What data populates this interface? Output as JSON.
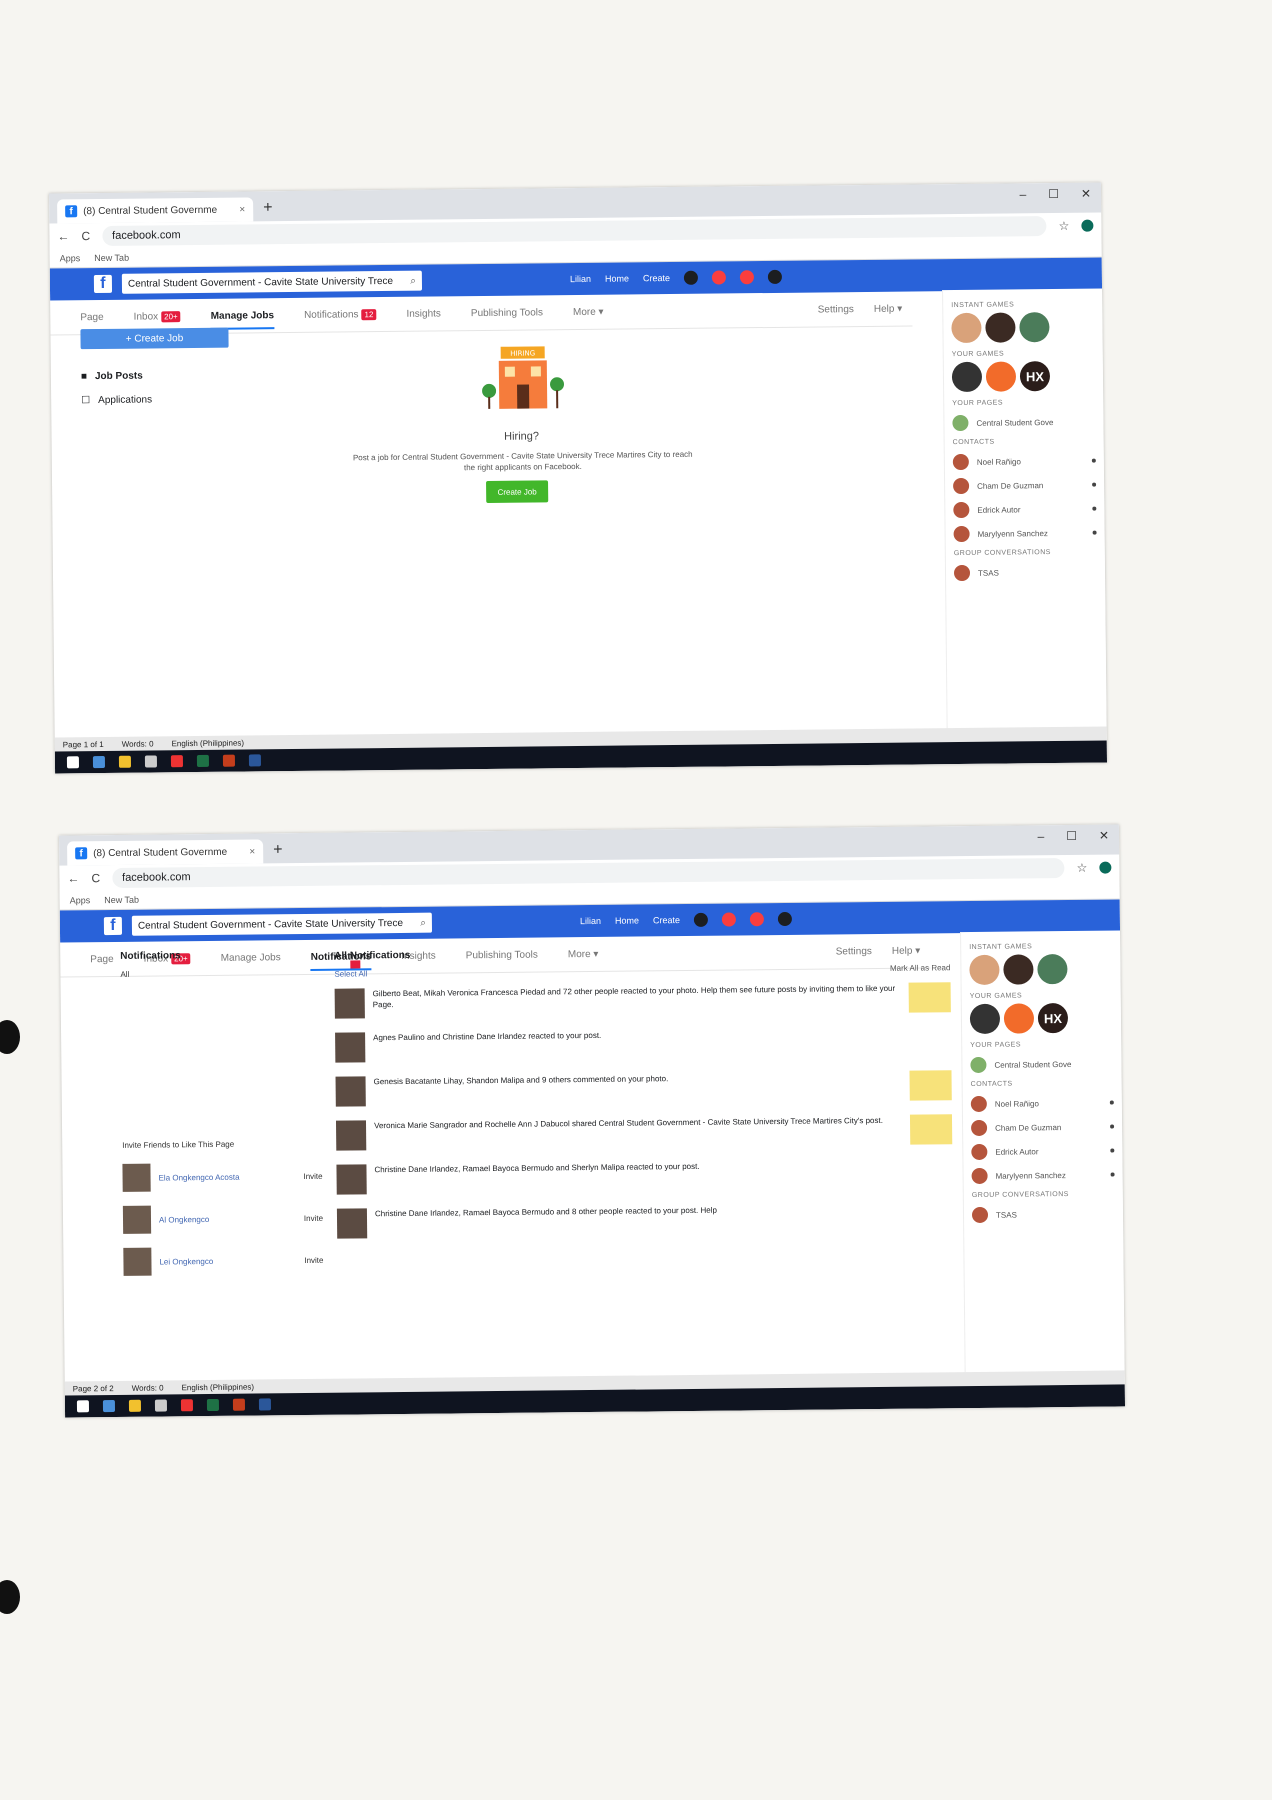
{
  "browser": {
    "tab1_title": "(8) Central Student Governme",
    "tab2_title": "(8) Central Student Governme",
    "url": "facebook.com",
    "bookmarks": [
      "Apps",
      "New Tab"
    ]
  },
  "fb": {
    "search": "Central Student Government - Cavite State University Trece",
    "topnav": [
      "Lilian",
      "Home",
      "Create"
    ],
    "tabs": {
      "page": "Page",
      "inbox": "Inbox",
      "inbox_badge": "20+",
      "manage_jobs": "Manage Jobs",
      "notifications": "Notifications",
      "notif_badge": "12",
      "insights": "Insights",
      "publishing": "Publishing Tools",
      "more": "More ▾",
      "settings": "Settings",
      "help": "Help ▾"
    }
  },
  "jobs": {
    "create_button": "+ Create Job",
    "nav": [
      "Job Posts",
      "Applications"
    ],
    "sign": "HIRING",
    "title": "Hiring?",
    "description": "Post a job for Central Student Government - Cavite State University Trece Martires City to reach the right applicants on Facebook.",
    "cta": "Create Job"
  },
  "sidebar": {
    "instant_games": "INSTANT GAMES",
    "your_games": "YOUR GAMES",
    "your_pages": "YOUR PAGES",
    "page_name": "Central Student Gove",
    "contacts_h": "CONTACTS",
    "contacts": [
      "Noel Rañigo",
      "Cham De Guzman",
      "Edrick Autor",
      "Marylyenn Sanchez"
    ],
    "group_h": "GROUP CONVERSATIONS",
    "group": "TSAS"
  },
  "notif": {
    "left_title": "Notifications",
    "left_all": "All",
    "all_title": "All Notifications",
    "select_all": "Select All",
    "mark_read": "Mark All as Read",
    "invite_title": "Invite Friends to Like This Page",
    "invite_label": "Invite",
    "invitees": [
      "Ela Ongkengco Acosta",
      "Al Ongkengco",
      "Lei Ongkengco"
    ],
    "items": [
      "Gilberto Beat, Mikah Veronica Francesca Piedad and 72 other people reacted to your photo. Help them see future posts by inviting them to like your Page.",
      "Agnes Paulino and Christine Dane Irlandez reacted to your post.",
      "Genesis Bacatante Lihay, Shandon Malipa and 9 others commented on your photo.",
      "Veronica Marie Sangrador and Rochelle Ann J Dabucol shared Central Student Government - Cavite State University Trece Martires City's post.",
      "Christine Dane Irlandez, Ramael Bayoca Bermudo and Sherlyn Malipa reacted to your post.",
      "Christine Dane Irlandez, Ramael Bayoca Bermudo and 8 other people reacted to your post. Help"
    ]
  },
  "status1": {
    "page": "Page 1 of 1",
    "words": "Words: 0",
    "lang": "English (Philippines)"
  },
  "status2": {
    "page": "Page 2 of 2",
    "words": "Words: 0",
    "lang": "English (Philippines)"
  }
}
